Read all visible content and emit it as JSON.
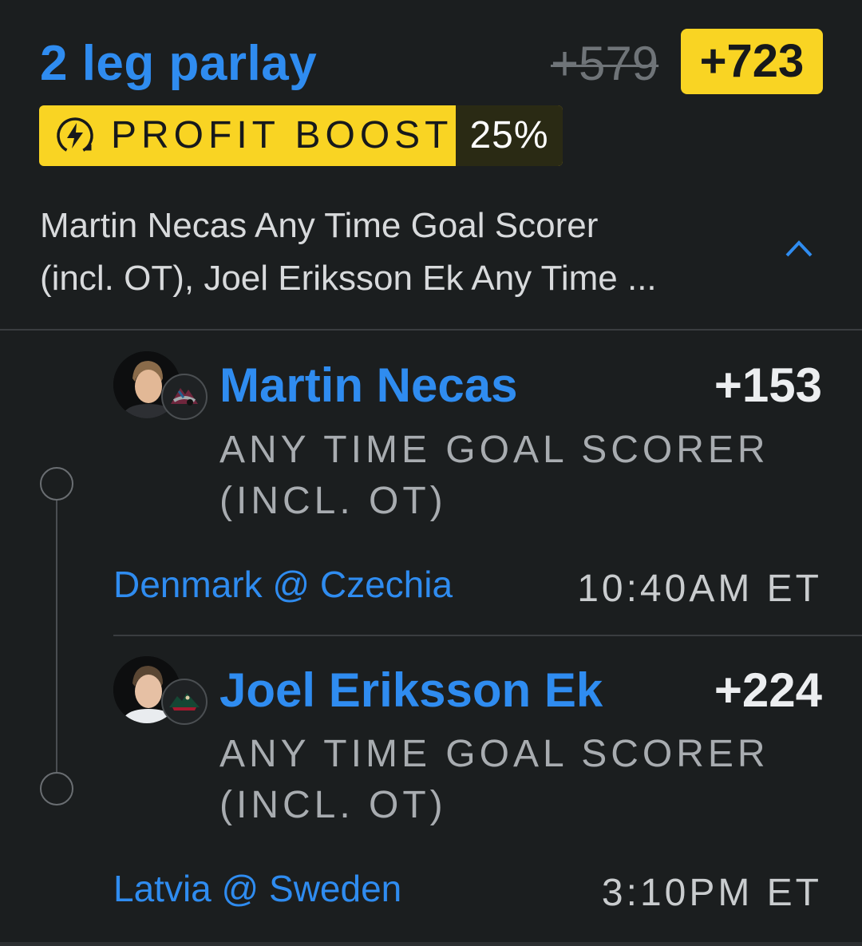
{
  "header": {
    "title": "2 leg parlay",
    "original_odds": "+579",
    "boosted_odds": "+723"
  },
  "boost": {
    "icon": "lightning-bolt-icon",
    "label": "PROFIT BOOST",
    "percent": "25%"
  },
  "summary": {
    "line1": "Martin Necas Any Time Goal Scorer",
    "line2": "(incl. OT), Joel Eriksson Ek Any Time ..."
  },
  "legs": [
    {
      "player": "Martin Necas",
      "odds": "+153",
      "market_line1": "ANY TIME GOAL SCORER",
      "market_line2": "(INCL. OT)",
      "matchup": "Denmark @ Czechia",
      "time": "10:40AM ET",
      "team_logo": "avalanche-logo-icon"
    },
    {
      "player": "Joel Eriksson Ek",
      "odds": "+224",
      "market_line1": "ANY TIME GOAL SCORER",
      "market_line2": "(INCL. OT)",
      "matchup": "Latvia @ Sweden",
      "time": "3:10PM ET",
      "team_logo": "wild-logo-icon"
    }
  ],
  "colors": {
    "accent_blue": "#2f8cf0",
    "boost_yellow": "#f9d423",
    "background": "#1b1e1f"
  }
}
